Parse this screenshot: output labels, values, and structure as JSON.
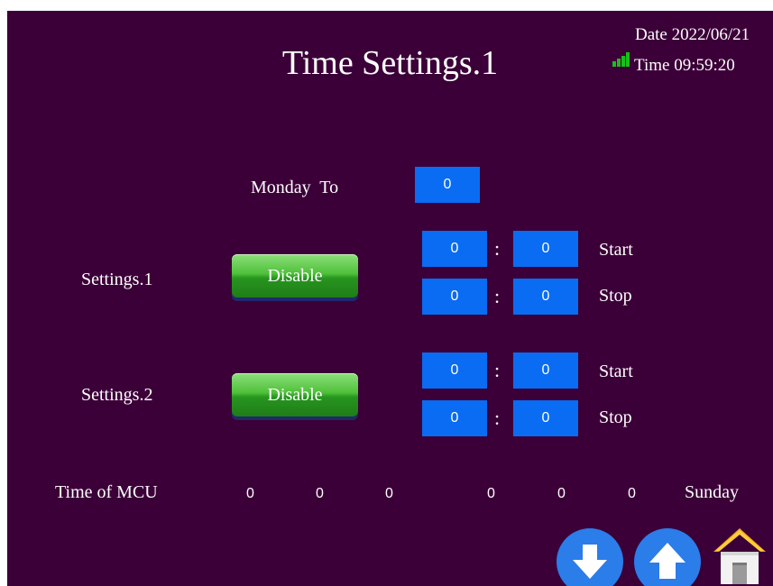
{
  "header": {
    "title": "Time Settings.1",
    "date_label": "Date",
    "date": "2022/06/21",
    "time_label": "Time",
    "time": "09:59:20"
  },
  "weekday": {
    "label": "Monday  To",
    "value": "0"
  },
  "settings": [
    {
      "label": "Settings.1",
      "button": "Disable",
      "start": {
        "hour": "0",
        "minute": "0",
        "label": "Start"
      },
      "stop": {
        "hour": "0",
        "minute": "0",
        "label": "Stop"
      }
    },
    {
      "label": "Settings.2",
      "button": "Disable",
      "start": {
        "hour": "0",
        "minute": "0",
        "label": "Start"
      },
      "stop": {
        "hour": "0",
        "minute": "0",
        "label": "Stop"
      }
    }
  ],
  "colon": ":",
  "mcu": {
    "label": "Time of MCU",
    "values": [
      "0",
      "0",
      "0",
      "0",
      "0",
      "0"
    ],
    "day": "Sunday"
  },
  "icons": {
    "signal": "signal-strength-icon",
    "down": "arrow-down-icon",
    "up": "arrow-up-icon",
    "home": "home-icon"
  },
  "colors": {
    "background": "#3b0038",
    "input": "#0a6cf2",
    "button": "#4fc03a",
    "nav": "#2b7de9",
    "signal": "#18c018"
  }
}
